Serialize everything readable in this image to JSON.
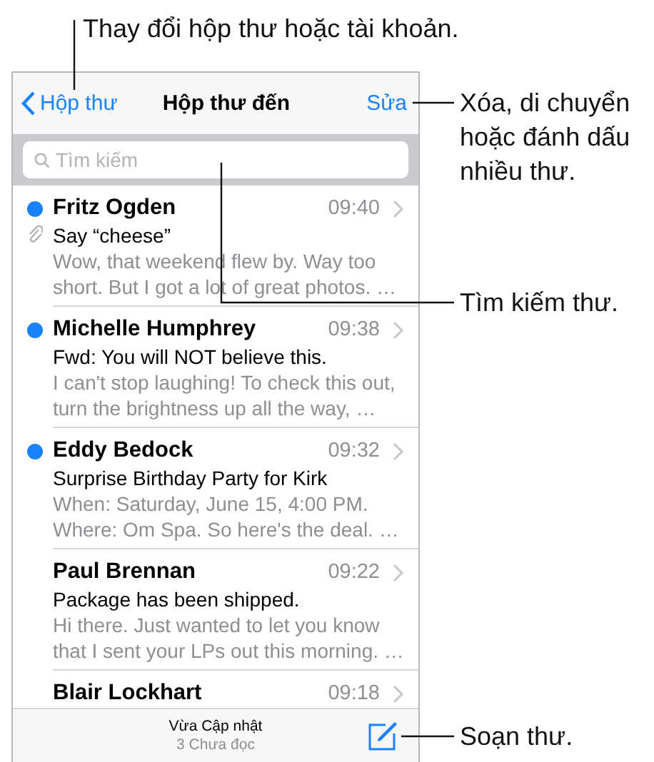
{
  "nav": {
    "back": "Hộp thư",
    "title": "Hộp thư đến",
    "edit": "Sửa"
  },
  "search": {
    "placeholder": "Tìm kiếm"
  },
  "messages": [
    {
      "sender": "Fritz Ogden",
      "time": "09:40",
      "subject": "Say “cheese”",
      "preview": "Wow, that weekend flew by. Way too short. But I got a lot of great photos. …",
      "unread": true,
      "attachment": true
    },
    {
      "sender": "Michelle Humphrey",
      "time": "09:38",
      "subject": "Fwd: You will NOT believe this.",
      "preview": "I can't stop laughing! To check this out, turn the brightness up all the way, …",
      "unread": true,
      "attachment": false
    },
    {
      "sender": "Eddy Bedock",
      "time": "09:32",
      "subject": "Surprise Birthday Party for Kirk",
      "preview": "When: Saturday, June 15, 4:00 PM. Where: Om Spa. So here's the deal. …",
      "unread": true,
      "attachment": false
    },
    {
      "sender": "Paul Brennan",
      "time": "09:22",
      "subject": "Package has been shipped.",
      "preview": "Hi there. Just wanted to let you know that I sent your LPs out this morning. …",
      "unread": false,
      "attachment": false
    },
    {
      "sender": "Blair Lockhart",
      "time": "09:18",
      "unread": false,
      "attachment": false
    }
  ],
  "toolbar": {
    "status": "Vừa Cập nhật",
    "unread_count": "3 Chưa đọc"
  },
  "callouts": [
    {
      "text": "Thay đổi hộp thư hoặc tài khoản."
    },
    {
      "text": "Xóa, di chuyển hoặc đánh dấu nhiều thư."
    },
    {
      "text": "Tìm kiếm thư."
    },
    {
      "text": "Soạn thư."
    }
  ]
}
